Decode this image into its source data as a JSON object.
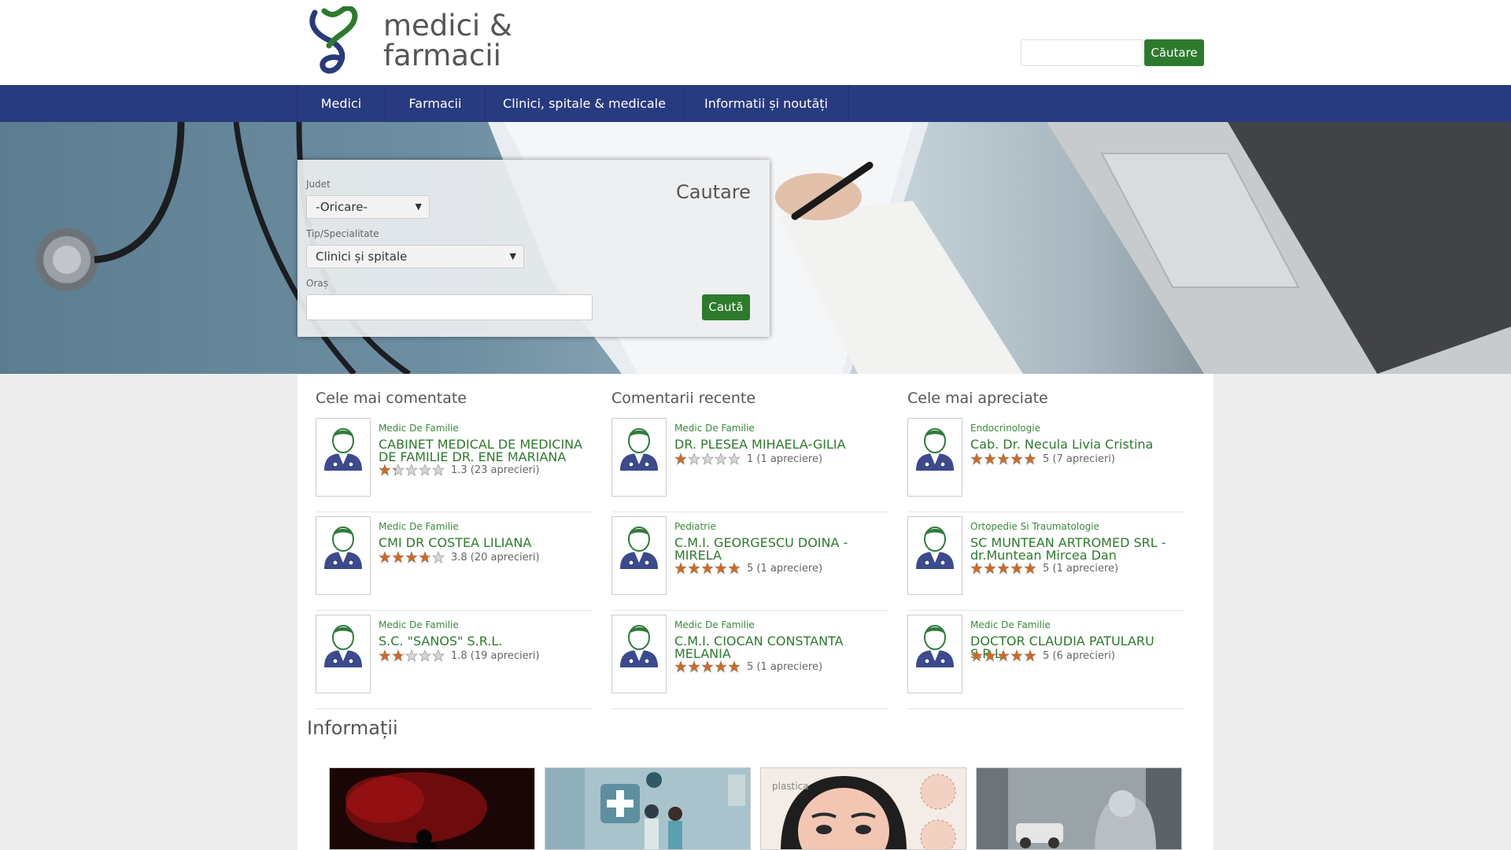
{
  "header": {
    "brand_line1": "medici &",
    "brand_line2": "farmacii",
    "search_button": "Căutare"
  },
  "nav": {
    "items": [
      "Medici",
      "Farmacii",
      "Clinici, spitale & medicale",
      "Informatii și noutăți"
    ]
  },
  "search_panel": {
    "title": "Cautare",
    "judet_label": "Judet",
    "judet_value": "-Oricare-",
    "tip_label": "Tip/Specialitate",
    "tip_value": "Clinici și spitale",
    "oras_label": "Oraș",
    "oras_value": "",
    "submit": "Caută"
  },
  "sections": {
    "most_commented": {
      "title": "Cele mai comentate",
      "items": [
        {
          "specialty": "Medic De Familie",
          "name": "CABINET MEDICAL DE MEDICINA DE FAMILIE DR. ENE MARIANA",
          "rating": 1.3,
          "rating_text": "1.3 (23 aprecieri)"
        },
        {
          "specialty": "Medic De Familie",
          "name": "CMI DR COSTEA LILIANA",
          "rating": 3.8,
          "rating_text": "3.8 (20 aprecieri)"
        },
        {
          "specialty": "Medic De Familie",
          "name": "S.C. \"SANOS\" S.R.L.",
          "rating": 1.8,
          "rating_text": "1.8 (19 aprecieri)"
        }
      ]
    },
    "recent_comments": {
      "title": "Comentarii recente",
      "items": [
        {
          "specialty": "Medic De Familie",
          "name": "DR. PLESEA MIHAELA-GILIA",
          "rating": 1,
          "rating_text": "1 (1 apreciere)"
        },
        {
          "specialty": "Pediatrie",
          "name": "C.M.I. GEORGESCU DOINA - MIRELA",
          "rating": 5,
          "rating_text": "5 (1 apreciere)"
        },
        {
          "specialty": "Medic De Familie",
          "name": "C.M.I. CIOCAN CONSTANTA MELANIA",
          "rating": 5,
          "rating_text": "5 (1 apreciere)"
        }
      ]
    },
    "top_rated": {
      "title": "Cele mai apreciate",
      "items": [
        {
          "specialty": "Endocrinologie",
          "name": "Cab. Dr. Necula Livia Cristina",
          "rating": 5,
          "rating_text": "5 (7 aprecieri)"
        },
        {
          "specialty": "Ortopedie Si Traumatologie",
          "name": "SC MUNTEAN ARTROMED SRL - dr.Muntean Mircea Dan",
          "rating": 5,
          "rating_text": "5 (1 apreciere)"
        },
        {
          "specialty": "Medic De Familie",
          "name": "DOCTOR CLAUDIA PATULARU S.R.L.",
          "rating": 5,
          "rating_text": "5 (6 aprecieri)"
        }
      ]
    }
  },
  "info": {
    "title": "Informații",
    "thumb3_caption": "plastica"
  },
  "colors": {
    "nav_bg": "#283b80",
    "accent_green": "#2d7a2d",
    "star_filled": "#d2691e",
    "star_empty": "#d6d6d6"
  }
}
